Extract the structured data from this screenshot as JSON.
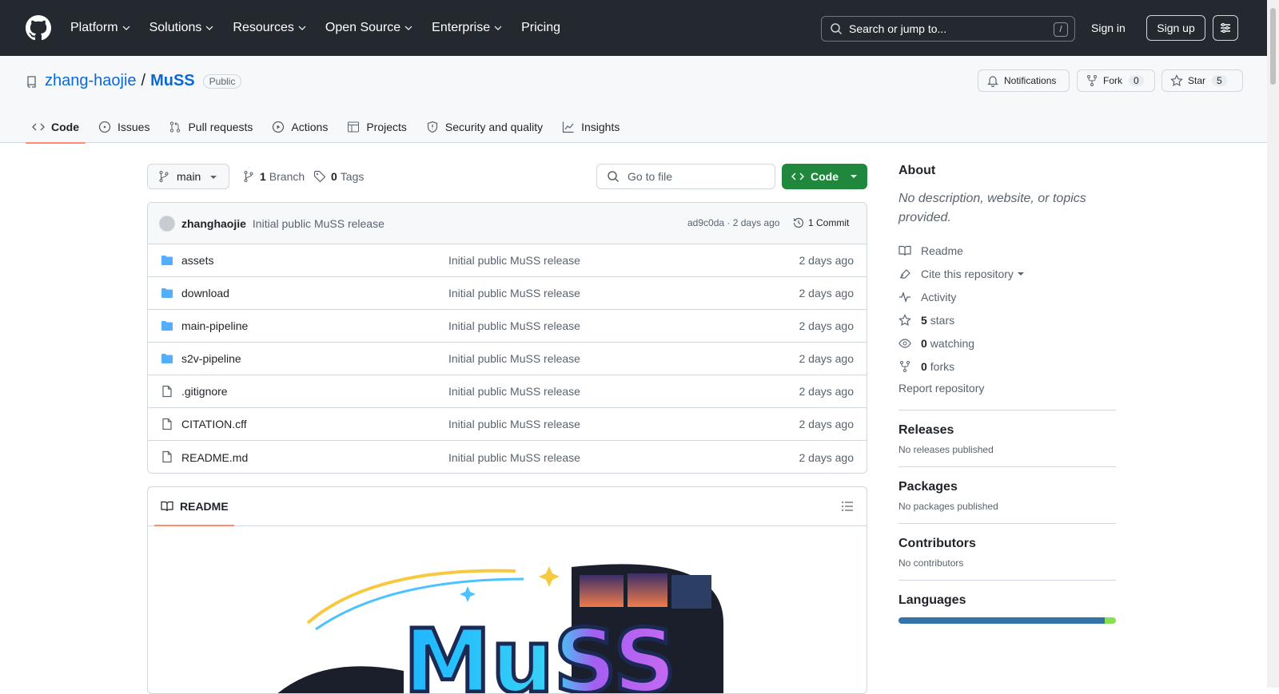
{
  "nav": {
    "items": [
      {
        "label": "Platform",
        "chevron": true
      },
      {
        "label": "Solutions",
        "chevron": true
      },
      {
        "label": "Resources",
        "chevron": true
      },
      {
        "label": "Open Source",
        "chevron": true
      },
      {
        "label": "Enterprise",
        "chevron": true
      },
      {
        "label": "Pricing",
        "chevron": false
      }
    ],
    "search_placeholder": "Search or jump to...",
    "search_shortcut": "/",
    "signin": "Sign in",
    "signup": "Sign up"
  },
  "repo": {
    "owner": "zhang-haojie",
    "separator": "/",
    "name": "MuSS",
    "visibility": "Public",
    "notifications": "Notifications",
    "fork_label": "Fork",
    "fork_count": "0",
    "star_label": "Star",
    "star_count": "5"
  },
  "tabs": [
    "Code",
    "Issues",
    "Pull requests",
    "Actions",
    "Projects",
    "Security and quality",
    "Insights"
  ],
  "toolbar": {
    "branch": "main",
    "branch_count": "1",
    "branch_label": "Branch",
    "tag_count": "0",
    "tag_label": "Tags",
    "goto_placeholder": "Go to file",
    "code_label": "Code"
  },
  "commit": {
    "author": "zhanghaojie",
    "message": "Initial public MuSS release",
    "sha_time": "ad9c0da · 2 days ago",
    "commits": "1 Commit"
  },
  "files": [
    {
      "name": "assets",
      "type": "folder",
      "message": "Initial public MuSS release",
      "time": "2 days ago"
    },
    {
      "name": "download",
      "type": "folder",
      "message": "Initial public MuSS release",
      "time": "2 days ago"
    },
    {
      "name": "main-pipeline",
      "type": "folder",
      "message": "Initial public MuSS release",
      "time": "2 days ago"
    },
    {
      "name": "s2v-pipeline",
      "type": "folder",
      "message": "Initial public MuSS release",
      "time": "2 days ago"
    },
    {
      "name": ".gitignore",
      "type": "file",
      "message": "Initial public MuSS release",
      "time": "2 days ago"
    },
    {
      "name": "CITATION.cff",
      "type": "file",
      "message": "Initial public MuSS release",
      "time": "2 days ago"
    },
    {
      "name": "README.md",
      "type": "file",
      "message": "Initial public MuSS release",
      "time": "2 days ago"
    }
  ],
  "readme": {
    "tab": "README",
    "logo_text": "MuSS"
  },
  "sidebar": {
    "about": "About",
    "description": "No description, website, or topics provided.",
    "readme": "Readme",
    "cite": "Cite this repository",
    "activity": "Activity",
    "stars_count": "5",
    "stars_label": "stars",
    "watching_count": "0",
    "watching_label": "watching",
    "forks_count": "0",
    "forks_label": "forks",
    "report": "Report repository",
    "releases": "Releases",
    "releases_note": "No releases published",
    "packages": "Packages",
    "packages_note": "No packages published",
    "contributors": "Contributors",
    "contributors_note": "No contributors",
    "languages": "Languages"
  },
  "colors": {
    "header_bg": "#24292f",
    "accent": "#0969da",
    "code_button": "#1f883d",
    "tab_underline": "#fd8c73",
    "folder": "#54aeff",
    "lang_primary": "#3572A5",
    "lang_secondary": "#89e051"
  }
}
